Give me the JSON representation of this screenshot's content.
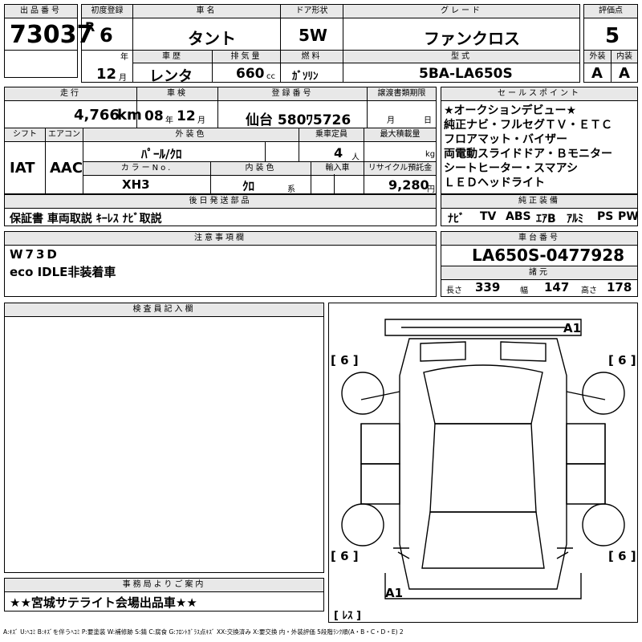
{
  "lot": {
    "label": "出品番号",
    "value": "73037"
  },
  "reg": {
    "label": "初度登録",
    "era": "R",
    "year": "6",
    "year_unit": "年",
    "month": "12",
    "month_unit": "月"
  },
  "car_name": {
    "label": "車名",
    "value": "タント"
  },
  "doors": {
    "label": "ドア形状",
    "value": "5W"
  },
  "grade": {
    "label": "グレード",
    "value": "ファンクロス"
  },
  "score": {
    "label": "評価点",
    "value": "5"
  },
  "history": {
    "label": "車歴",
    "value": "レンタ"
  },
  "displacement": {
    "label": "排気量",
    "value": "660",
    "unit": "cc"
  },
  "fuel": {
    "label": "燃料",
    "value": "ｶﾞｿﾘﾝ"
  },
  "model": {
    "label": "型式",
    "value": "5BA-LA650S"
  },
  "exterior": {
    "label": "外装",
    "value": "A"
  },
  "interior": {
    "label": "内装",
    "value": "A"
  },
  "mileage": {
    "label": "走行",
    "value": "4,766",
    "unit": "km"
  },
  "inspection": {
    "label": "車検",
    "year": "08",
    "year_unit": "年",
    "month": "12",
    "month_unit": "月"
  },
  "plate": {
    "label": "登録番号",
    "value": "仙台 580ﾜ5726"
  },
  "transfer_doc": {
    "label": "譲渡書類期限",
    "month_unit": "月",
    "day_unit": "日"
  },
  "shift": {
    "label": "シフト",
    "value": "IAT"
  },
  "ac": {
    "label": "エアコン",
    "value": "AAC"
  },
  "color": {
    "label": "外装色",
    "value": "ﾊﾟｰﾙ/ｸﾛ"
  },
  "capacity": {
    "label": "乗車定員",
    "value": "4",
    "unit": "人"
  },
  "max_load": {
    "label": "最大積載量",
    "unit": "kg"
  },
  "color_no": {
    "label": "カラーNo.",
    "value": "XH3"
  },
  "interior_color": {
    "label": "内装色",
    "value": "ｸﾛ",
    "unit": "系"
  },
  "import": {
    "label": "輸入車"
  },
  "recycle": {
    "label": "リサイクル預託金",
    "value": "9,280",
    "unit": "円"
  },
  "later_items": {
    "label": "後日発送部品",
    "value": "保証書 車両取説 ｷｰﾚｽ ﾅﾋﾞ取説"
  },
  "notes": {
    "label": "注意事項欄",
    "lines": [
      "W73D",
      "eco IDLE非装着車"
    ]
  },
  "sales_points": {
    "label": "セールスポイント",
    "lines": [
      "★オークションデビュー★",
      "純正ナビ・フルセグＴＶ・ＥＴＣ",
      "フロアマット・バイザー",
      "両電動スライドドア・Ｂモニター",
      "シートヒーター・スマアシ",
      "ＬＥＤヘッドライト"
    ]
  },
  "equipment": {
    "label": "純正装備",
    "items": [
      "ﾅﾋﾞ",
      "TV",
      "ABS",
      "ｴｱB",
      "ｱﾙﾐ",
      "PS",
      "PW"
    ]
  },
  "chassis": {
    "label": "車台番号",
    "value": "LA650S-0477928"
  },
  "specs": {
    "label": "諸元",
    "length_label": "長さ",
    "length": "339",
    "width_label": "幅",
    "width": "147",
    "height_label": "高さ",
    "height": "178"
  },
  "inspector": {
    "label": "検査員記入欄"
  },
  "office": {
    "label": "事務局よりご案内",
    "value": "★★宮城サテライト会場出品車★★"
  },
  "diagram": {
    "tire_marks": [
      "[ 6 ]",
      "[ 6 ]",
      "[ 6 ]",
      "[ 6 ]"
    ],
    "damage_front": "A1",
    "damage_rear": "A1",
    "spare": "[ ﾚｽ ]"
  },
  "legend": "A:ｷｽﾞ U:ﾍｺﾐ B:ｷｽﾞを伴うﾍｺﾐ P:要塗装 W:補修跡 S:錆 C:腐食 G:ﾌﾛﾝﾄｶﾞﾗｽ点ｷｽﾞ XX:交換済み X:要交換 内・外装評価 5段階ﾗﾝｸ順(A・B・C・D・E) 2"
}
